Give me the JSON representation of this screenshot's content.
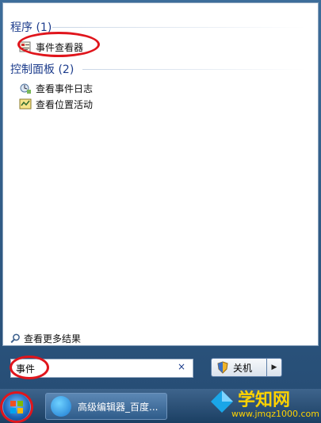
{
  "results": {
    "groups": [
      {
        "title": "程序 (1)",
        "items": [
          {
            "label": "事件查看器",
            "icon": "event-viewer-icon"
          }
        ]
      },
      {
        "title": "控制面板 (2)",
        "items": [
          {
            "label": "查看事件日志",
            "icon": "event-log-icon"
          },
          {
            "label": "查看位置活动",
            "icon": "location-activity-icon"
          }
        ]
      }
    ],
    "see_more": "查看更多结果"
  },
  "search": {
    "value": "事件",
    "clear_icon": "×"
  },
  "shutdown": {
    "label": "关机",
    "arrow_icon": "▶"
  },
  "taskbar": {
    "task_label": "高级编辑器_百度..."
  },
  "watermark": {
    "title": "学知网",
    "url": "www.jmqz1000.com"
  },
  "colors": {
    "annotation": "#e0151c",
    "group_title": "#1c3c8c",
    "watermark": "#ffd200"
  }
}
